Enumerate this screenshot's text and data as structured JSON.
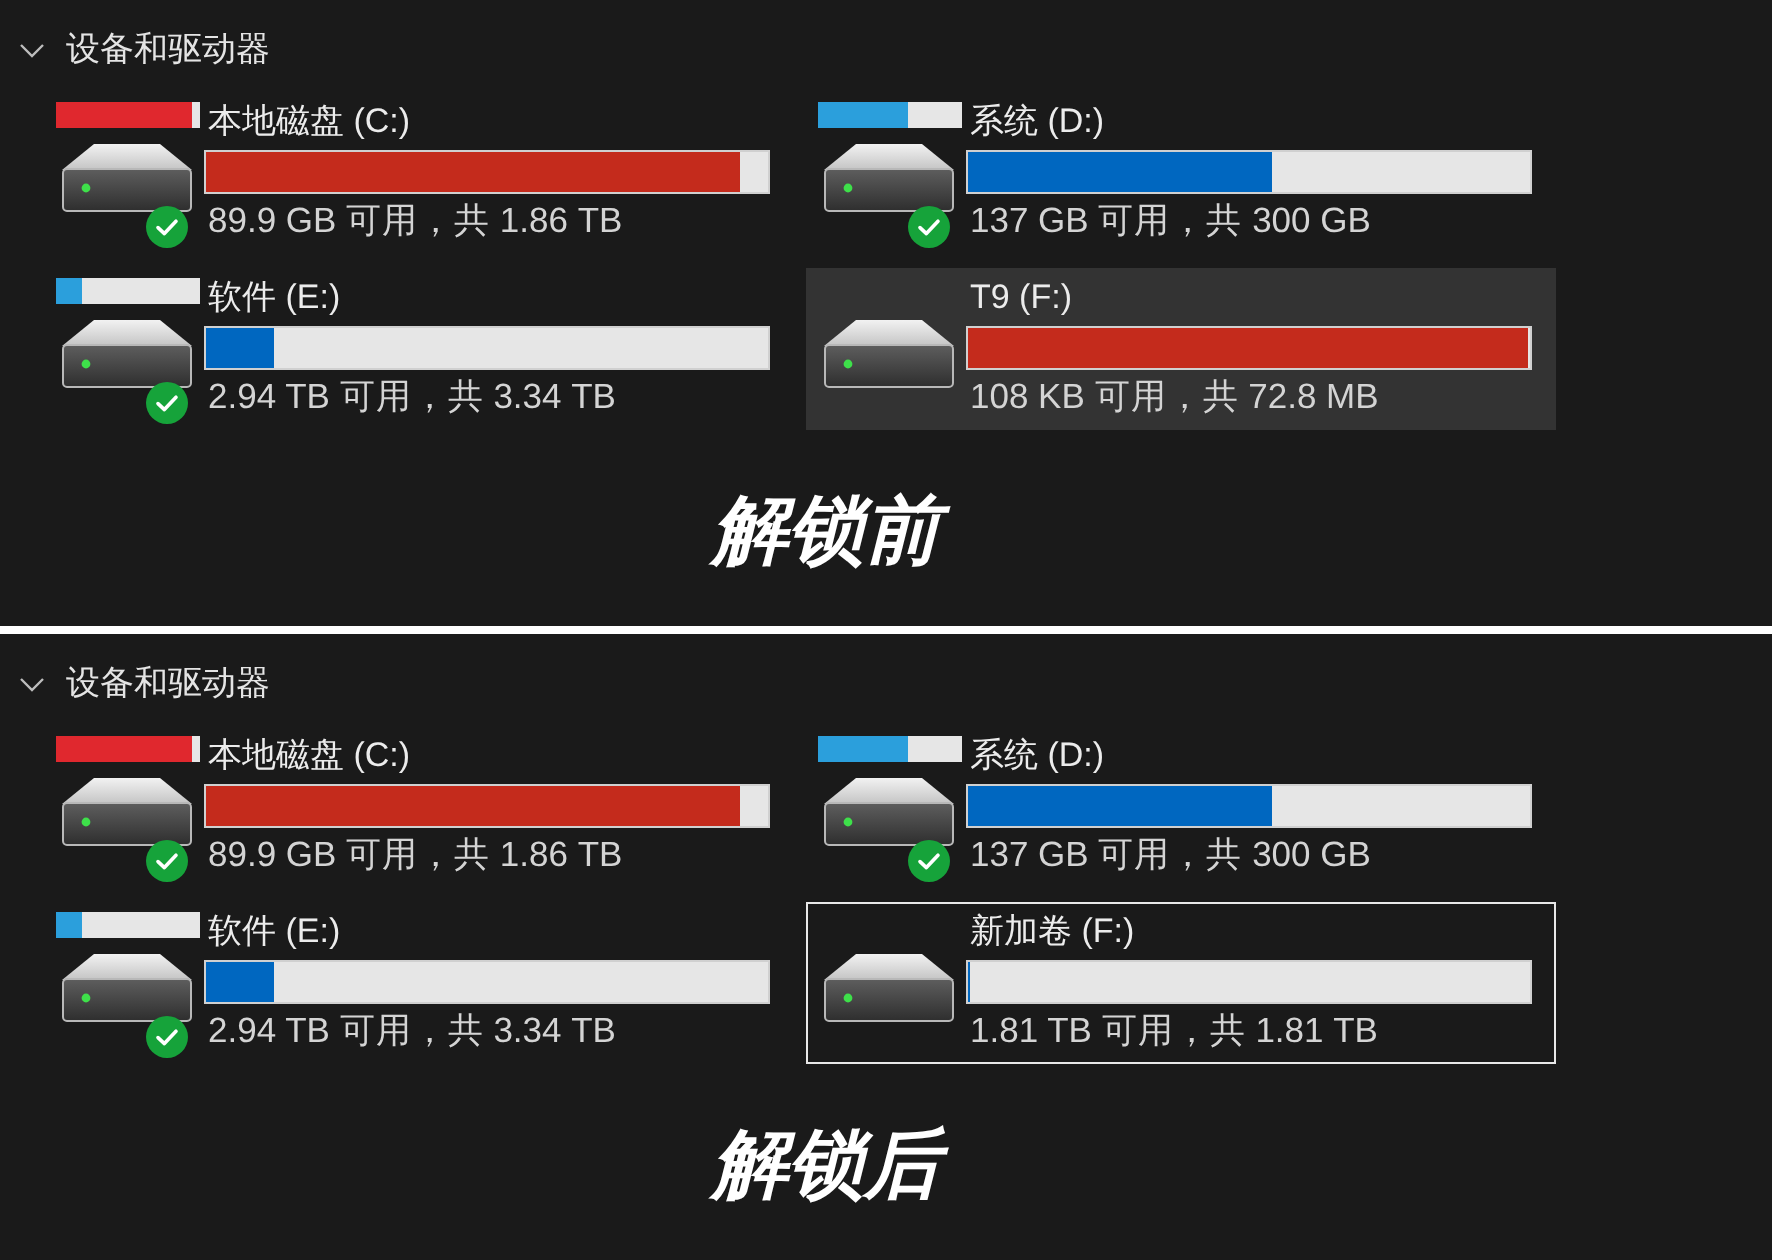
{
  "panels": [
    {
      "section": {
        "title": "设备和驱动器",
        "expanded": true
      },
      "drives": [
        {
          "name": "本地磁盘 (C:)",
          "level": 0.95,
          "usage": "89.9 GB 可用，共 1.86 TB",
          "icon_bar": {
            "level": 0.94
          },
          "status_ok": true,
          "selected": false,
          "focused": false
        },
        {
          "name": "系统 (D:)",
          "level": 0.54,
          "usage": "137 GB 可用，共 300 GB",
          "icon_bar": {
            "level": 0.62
          },
          "status_ok": true,
          "selected": false,
          "focused": false
        },
        {
          "name": "软件 (E:)",
          "level": 0.12,
          "usage": "2.94 TB 可用，共 3.34 TB",
          "icon_bar": {
            "level": 0.18
          },
          "status_ok": true,
          "selected": false,
          "focused": false
        },
        {
          "name": "T9 (F:)",
          "level": 0.998,
          "usage": "108 KB 可用，共 72.8 MB",
          "status_ok": false,
          "selected": true,
          "focused": false
        }
      ],
      "caption": "解锁前"
    },
    {
      "section": {
        "title": "设备和驱动器",
        "expanded": true
      },
      "drives": [
        {
          "name": "本地磁盘 (C:)",
          "level": 0.95,
          "usage": "89.9 GB 可用，共 1.86 TB",
          "icon_bar": {
            "level": 0.94
          },
          "status_ok": true,
          "selected": false,
          "focused": false
        },
        {
          "name": "系统 (D:)",
          "level": 0.54,
          "usage": "137 GB 可用，共 300 GB",
          "icon_bar": {
            "level": 0.62
          },
          "status_ok": true,
          "selected": false,
          "focused": false
        },
        {
          "name": "软件 (E:)",
          "level": 0.12,
          "usage": "2.94 TB 可用，共 3.34 TB",
          "icon_bar": {
            "level": 0.18
          },
          "status_ok": true,
          "selected": false,
          "focused": false
        },
        {
          "name": "新加卷 (F:)",
          "level": 0,
          "usage": "1.81 TB 可用，共 1.81 TB",
          "status_ok": false,
          "selected": false,
          "focused": true
        }
      ],
      "caption": "解锁后"
    }
  ]
}
